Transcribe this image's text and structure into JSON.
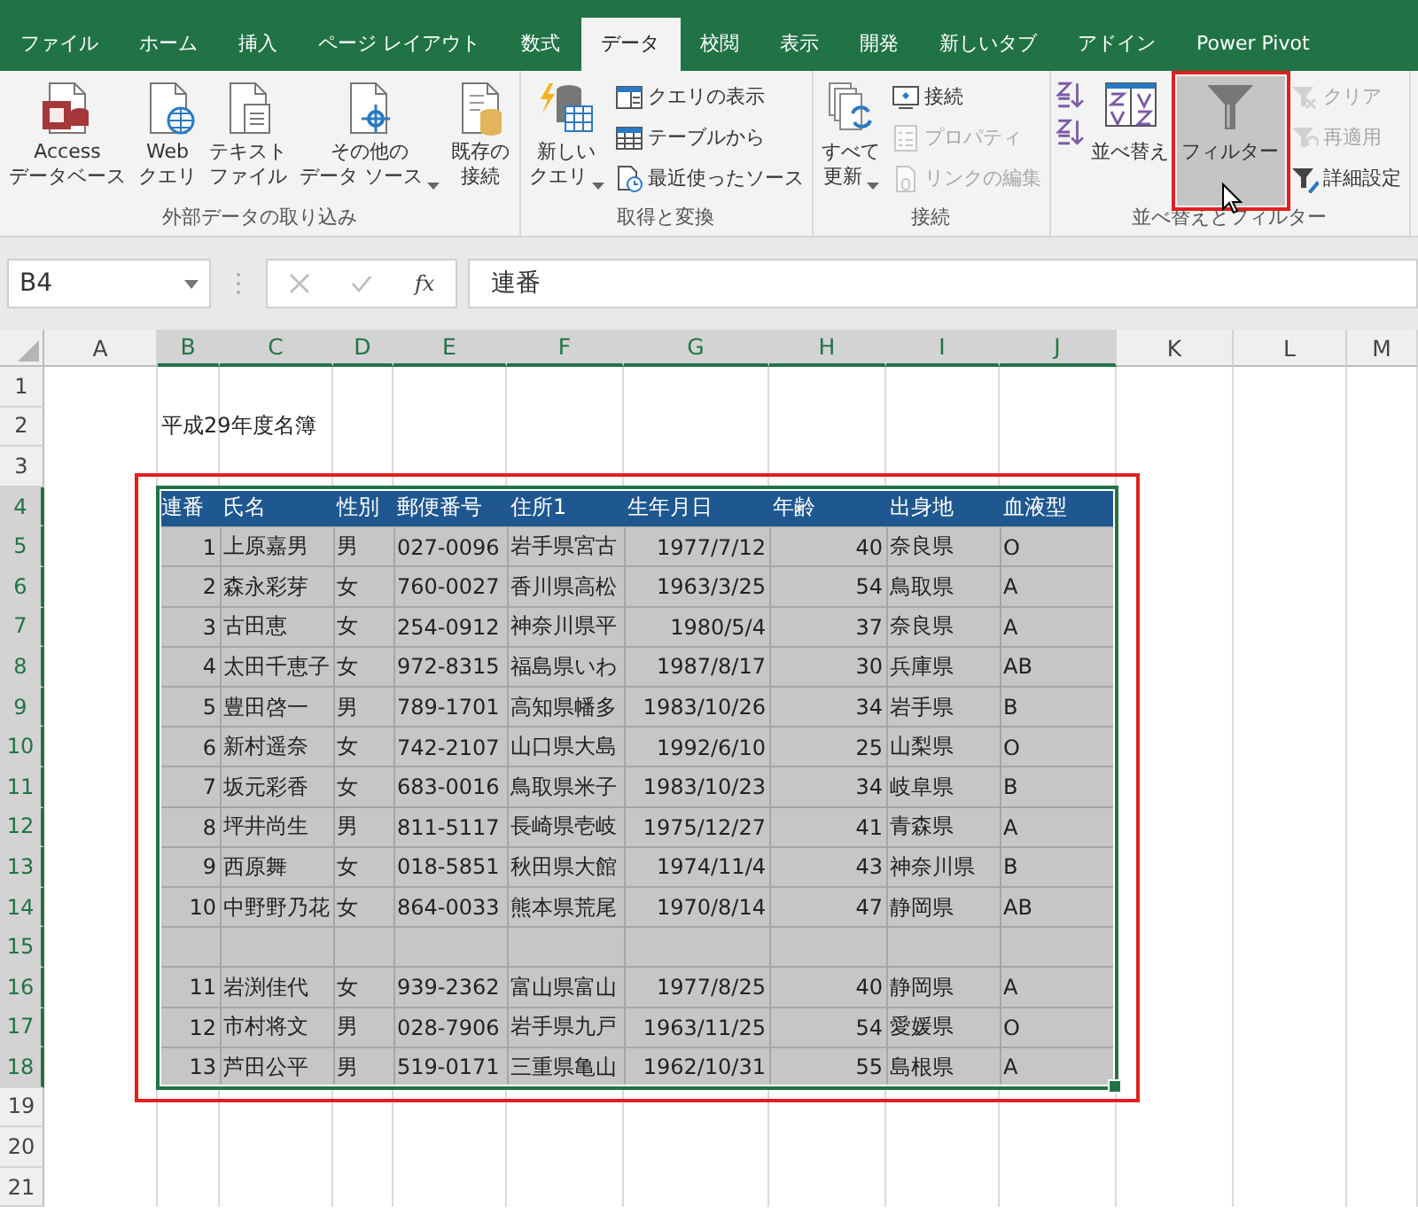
{
  "ribbon": {
    "tabs": [
      {
        "label": "ファイル",
        "selected": false
      },
      {
        "label": "ホーム",
        "selected": false
      },
      {
        "label": "挿入",
        "selected": false
      },
      {
        "label": "ページ レイアウト",
        "selected": false
      },
      {
        "label": "数式",
        "selected": false
      },
      {
        "label": "データ",
        "selected": true
      },
      {
        "label": "校閲",
        "selected": false
      },
      {
        "label": "表示",
        "selected": false
      },
      {
        "label": "開発",
        "selected": false
      },
      {
        "label": "新しいタブ",
        "selected": false
      },
      {
        "label": "アドイン",
        "selected": false
      },
      {
        "label": "Power Pivot",
        "selected": false
      }
    ],
    "groups": [
      {
        "label": "外部データの取り込み",
        "items": [
          {
            "kind": "large",
            "lines": [
              "Access",
              "データベース"
            ],
            "disabled": false,
            "dropdown": false,
            "highlighted": false
          },
          {
            "kind": "large",
            "lines": [
              "Web",
              "クエリ"
            ],
            "disabled": false,
            "dropdown": false,
            "highlighted": false
          },
          {
            "kind": "large",
            "lines": [
              "テキスト",
              "ファイル"
            ],
            "disabled": false,
            "dropdown": false,
            "highlighted": false
          },
          {
            "kind": "large",
            "lines": [
              "その他の",
              "データ ソース"
            ],
            "disabled": false,
            "dropdown": true,
            "highlighted": false
          },
          {
            "kind": "large",
            "lines": [
              "既存の",
              "接続"
            ],
            "disabled": false,
            "dropdown": false,
            "highlighted": false
          }
        ]
      },
      {
        "label": "取得と変換",
        "items": [
          {
            "kind": "large",
            "lines": [
              "新しい",
              "クエリ"
            ],
            "disabled": false,
            "dropdown": true,
            "highlighted": false
          },
          {
            "kind": "small",
            "label": "クエリの表示",
            "disabled": false
          },
          {
            "kind": "small",
            "label": "テーブルから",
            "disabled": false
          },
          {
            "kind": "small",
            "label": "最近使ったソース",
            "disabled": false
          }
        ]
      },
      {
        "label": "接続",
        "items": [
          {
            "kind": "large",
            "lines": [
              "すべて",
              "更新"
            ],
            "disabled": false,
            "dropdown": true,
            "highlighted": false
          },
          {
            "kind": "small",
            "label": "接続",
            "disabled": false
          },
          {
            "kind": "small",
            "label": "プロパティ",
            "disabled": true
          },
          {
            "kind": "small",
            "label": "リンクの編集",
            "disabled": true
          }
        ]
      },
      {
        "label": "並べ替えとフィルター",
        "items": [
          {
            "kind": "icon",
            "disabled": false
          },
          {
            "kind": "icon",
            "disabled": false
          },
          {
            "kind": "large",
            "lines": [
              "並べ替え"
            ],
            "disabled": false,
            "dropdown": false,
            "highlighted": false
          },
          {
            "kind": "large",
            "lines": [
              "フィルター"
            ],
            "disabled": false,
            "dropdown": false,
            "highlighted": true
          },
          {
            "kind": "small",
            "label": "クリア",
            "disabled": true
          },
          {
            "kind": "small",
            "label": "再適用",
            "disabled": true
          },
          {
            "kind": "small",
            "label": "詳細設定",
            "disabled": false
          }
        ]
      }
    ]
  },
  "formula_bar": {
    "name_box": "B4",
    "function_button": "fx",
    "formula": "連番"
  },
  "sheet": {
    "columns": [
      {
        "letter": "A",
        "selected": false
      },
      {
        "letter": "B",
        "selected": true
      },
      {
        "letter": "C",
        "selected": true
      },
      {
        "letter": "D",
        "selected": true
      },
      {
        "letter": "E",
        "selected": true
      },
      {
        "letter": "F",
        "selected": true
      },
      {
        "letter": "G",
        "selected": true
      },
      {
        "letter": "H",
        "selected": true
      },
      {
        "letter": "I",
        "selected": true
      },
      {
        "letter": "J",
        "selected": true
      },
      {
        "letter": "K",
        "selected": false
      },
      {
        "letter": "L",
        "selected": false
      },
      {
        "letter": "M",
        "selected": false
      }
    ],
    "rows": [
      {
        "number": "1",
        "selected": false
      },
      {
        "number": "2",
        "selected": false
      },
      {
        "number": "3",
        "selected": false
      },
      {
        "number": "4",
        "selected": true
      },
      {
        "number": "5",
        "selected": true
      },
      {
        "number": "6",
        "selected": true
      },
      {
        "number": "7",
        "selected": true
      },
      {
        "number": "8",
        "selected": true
      },
      {
        "number": "9",
        "selected": true
      },
      {
        "number": "10",
        "selected": true
      },
      {
        "number": "11",
        "selected": true
      },
      {
        "number": "12",
        "selected": true
      },
      {
        "number": "13",
        "selected": true
      },
      {
        "number": "14",
        "selected": true
      },
      {
        "number": "15",
        "selected": true
      },
      {
        "number": "16",
        "selected": true
      },
      {
        "number": "17",
        "selected": true
      },
      {
        "number": "18",
        "selected": true
      },
      {
        "number": "19",
        "selected": false
      },
      {
        "number": "20",
        "selected": false
      },
      {
        "number": "21",
        "selected": false
      }
    ],
    "title": "平成29年度名簿",
    "table": {
      "annotated": true,
      "headers": [
        "連番",
        "氏名",
        "性別",
        "郵便番号",
        "住所1",
        "生年月日",
        "年齢",
        "出身地",
        "血液型"
      ],
      "records": [
        {
          "kind": "record",
          "values": [
            "1",
            "上原嘉男",
            "男",
            "027-0096",
            "岩手県宮古",
            "1977/7/12",
            "40",
            "奈良県",
            "O"
          ]
        },
        {
          "kind": "record",
          "values": [
            "2",
            "森永彩芽",
            "女",
            "760-0027",
            "香川県高松",
            "1963/3/25",
            "54",
            "鳥取県",
            "A"
          ]
        },
        {
          "kind": "record",
          "values": [
            "3",
            "古田恵",
            "女",
            "254-0912",
            "神奈川県平",
            "1980/5/4",
            "37",
            "奈良県",
            "A"
          ]
        },
        {
          "kind": "record",
          "values": [
            "4",
            "太田千恵子",
            "女",
            "972-8315",
            "福島県いわ",
            "1987/8/17",
            "30",
            "兵庫県",
            "AB"
          ]
        },
        {
          "kind": "record",
          "values": [
            "5",
            "豊田啓一",
            "男",
            "789-1701",
            "高知県幡多",
            "1983/10/26",
            "34",
            "岩手県",
            "B"
          ]
        },
        {
          "kind": "record",
          "values": [
            "6",
            "新村遥奈",
            "女",
            "742-2107",
            "山口県大島",
            "1992/6/10",
            "25",
            "山梨県",
            "O"
          ]
        },
        {
          "kind": "record",
          "values": [
            "7",
            "坂元彩香",
            "女",
            "683-0016",
            "鳥取県米子",
            "1983/10/23",
            "34",
            "岐阜県",
            "B"
          ]
        },
        {
          "kind": "record",
          "values": [
            "8",
            "坪井尚生",
            "男",
            "811-5117",
            "長崎県壱岐",
            "1975/12/27",
            "41",
            "青森県",
            "A"
          ]
        },
        {
          "kind": "record",
          "values": [
            "9",
            "西原舞",
            "女",
            "018-5851",
            "秋田県大館",
            "1974/11/4",
            "43",
            "神奈川県",
            "B"
          ]
        },
        {
          "kind": "record",
          "values": [
            "10",
            "中野野乃花",
            "女",
            "864-0033",
            "熊本県荒尾",
            "1970/8/14",
            "47",
            "静岡県",
            "AB"
          ]
        },
        {
          "kind": "blank"
        },
        {
          "kind": "record",
          "values": [
            "11",
            "岩渕佳代",
            "女",
            "939-2362",
            "富山県富山",
            "1977/8/25",
            "40",
            "静岡県",
            "A"
          ]
        },
        {
          "kind": "record",
          "values": [
            "12",
            "市村将文",
            "男",
            "028-7906",
            "岩手県九戸",
            "1963/11/25",
            "54",
            "愛媛県",
            "O"
          ]
        },
        {
          "kind": "record",
          "values": [
            "13",
            "芦田公平",
            "男",
            "519-0171",
            "三重県亀山",
            "1962/10/31",
            "55",
            "島根県",
            "A"
          ]
        }
      ]
    }
  }
}
